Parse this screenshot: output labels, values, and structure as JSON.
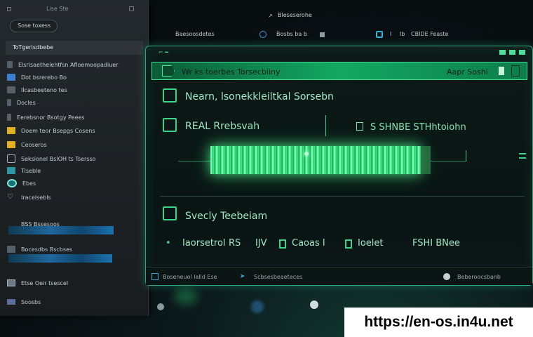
{
  "sidebar": {
    "top_label": "Lise Ste",
    "pill_label": "Sose toxess",
    "section_label": "ToTgerisdbebe",
    "items": [
      {
        "label": "Elsrisaethelehtfsn Afloemoopadiuer",
        "icon": "app-icon"
      },
      {
        "label": "Dot bsrerebo Bo",
        "icon": "window-icon"
      },
      {
        "label": "Ilcasbeeteno tes",
        "icon": "folder-icon"
      },
      {
        "label": "Docles",
        "icon": "doc-icon"
      },
      {
        "label": "Eerebsnor Bsotgy Peees",
        "icon": "user-icon"
      },
      {
        "label": "Ooem teor Bsepgs Cosens",
        "icon": "folder-icon"
      },
      {
        "label": "Ceoseros",
        "icon": "file-icon"
      },
      {
        "label": "Seksionel BsIOH ts Tsersso",
        "icon": "monitor-icon"
      },
      {
        "label": "Tiseble",
        "icon": "info-icon"
      },
      {
        "label": "Ebes",
        "icon": "cloud-icon"
      },
      {
        "label": "Iracelsebls",
        "icon": "heart-icon"
      },
      {
        "label": "BSS Bssesoos",
        "icon": "wave-icon"
      },
      {
        "label": "Bocesdbs Bscbses",
        "icon": "chart-icon"
      },
      {
        "label": "Etse Oeir tsescel",
        "icon": "folder-icon"
      },
      {
        "label": "Soosbs",
        "icon": "list-icon"
      }
    ]
  },
  "topbar": {
    "title": "Bleseserohe",
    "items": [
      "Baesoosdetes",
      "Bosbs ba b",
      "I",
      "Ib",
      "CBIDE Feaste"
    ]
  },
  "window": {
    "header_title": "Wr ks toerbes Torsecbiiny",
    "header_right": "Aapr Soshi",
    "rows": [
      {
        "label": "Nearn, lsonekkleiltkal Sorsebn"
      },
      {
        "label": "REAL Rrebsvah"
      },
      {
        "label": "Svecly Teebeiam"
      }
    ],
    "status_right": "S SHNBE STHhtoiohn",
    "stats": [
      "Iaorsetrol",
      "RS",
      "IJV",
      "Caoas I",
      "Ioelet",
      "FSHI BNee"
    ],
    "bottom": [
      "Boseneuol lalld Ese",
      "Scbsesbeaeteces",
      "Beberoocsbanb"
    ]
  },
  "footer_url": "https://en-os.in4u.net",
  "colors": {
    "accent": "#3ed28a",
    "header_bg": "#12a863",
    "sidebar_bg": "#24292d"
  }
}
